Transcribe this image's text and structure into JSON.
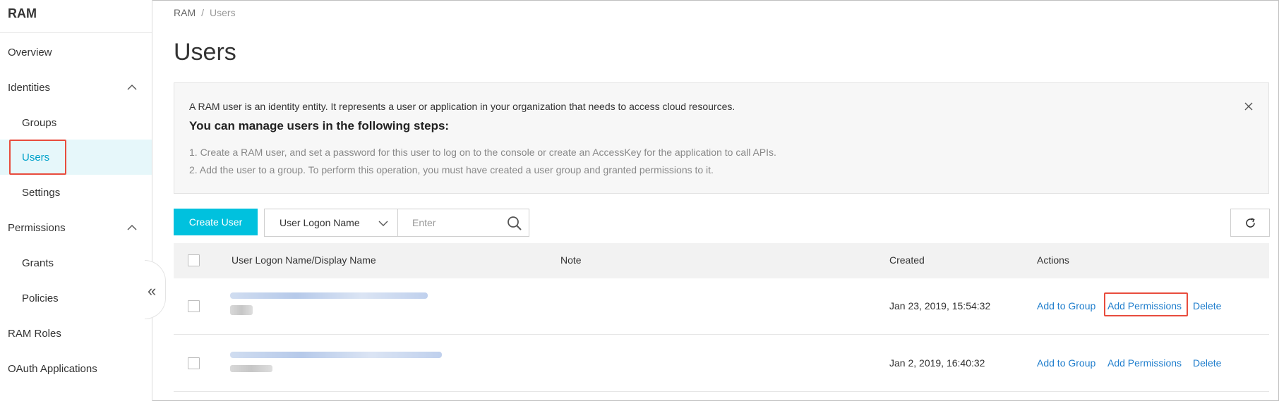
{
  "sidebar": {
    "title": "RAM",
    "items": [
      {
        "label": "Overview"
      },
      {
        "label": "Identities"
      },
      {
        "label": "Groups"
      },
      {
        "label": "Users"
      },
      {
        "label": "Settings"
      },
      {
        "label": "Permissions"
      },
      {
        "label": "Grants"
      },
      {
        "label": "Policies"
      },
      {
        "label": "RAM Roles"
      },
      {
        "label": "OAuth Applications"
      }
    ],
    "active_item": "Users",
    "collapse_icon": "double-chevron-left-icon"
  },
  "breadcrumb": {
    "root": "RAM",
    "separator": "/",
    "current": "Users"
  },
  "page": {
    "title": "Users"
  },
  "info": {
    "line1": "A RAM user is an identity entity. It represents a user or application in your organization that needs to access cloud resources.",
    "heading": "You can manage users in the following steps:",
    "steps": [
      "1. Create a RAM user, and set a password for this user to log on to the console or create an AccessKey for the application to call APIs.",
      "2. Add the user to a group. To perform this operation, you must have created a user group and granted permissions to it."
    ]
  },
  "toolbar": {
    "create_label": "Create User",
    "filter_select": "User Logon Name",
    "search_placeholder": "Enter"
  },
  "table": {
    "headers": {
      "name": "User Logon Name/Display Name",
      "note": "Note",
      "created": "Created",
      "actions": "Actions"
    },
    "rows": [
      {
        "created": "Jan 23, 2019, 15:54:32",
        "add_group": "Add to Group",
        "add_perm": "Add Permissions",
        "delete": "Delete"
      },
      {
        "created": "Jan 2, 2019, 16:40:32",
        "add_group": "Add to Group",
        "add_perm": "Add Permissions",
        "delete": "Delete"
      }
    ]
  },
  "colors": {
    "accent": "#00c1de",
    "link": "#1e7dcc",
    "highlight": "#e84c3d",
    "active_bg": "#e6f7fa"
  }
}
